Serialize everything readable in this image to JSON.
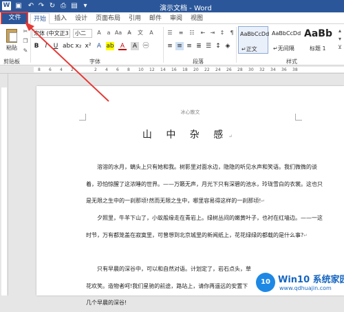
{
  "window": {
    "title": "演示文档 - Word",
    "app_icon_letter": "W"
  },
  "quick_access": [
    "save-icon",
    "undo-icon",
    "redo-icon",
    "refresh-icon",
    "print-icon",
    "open-icon"
  ],
  "tabs": [
    {
      "label": "文件"
    },
    {
      "label": "开始"
    },
    {
      "label": "插入"
    },
    {
      "label": "设计"
    },
    {
      "label": "页面布局"
    },
    {
      "label": "引用"
    },
    {
      "label": "邮件"
    },
    {
      "label": "审阅"
    },
    {
      "label": "视图"
    }
  ],
  "ribbon": {
    "clipboard": {
      "paste_label": "粘贴",
      "group_label": "剪贴板"
    },
    "font": {
      "font_name": "宋体 (中文正3",
      "font_size": "小二",
      "group_label": "字体"
    },
    "paragraph": {
      "group_label": "段落"
    },
    "styles": {
      "group_label": "样式",
      "items": [
        {
          "preview": "AaBbCcDd",
          "name": "↵正文"
        },
        {
          "preview": "AaBbCcDd",
          "name": "↵无间隔"
        },
        {
          "preview": "AaBb",
          "name": "标题 1"
        }
      ]
    }
  },
  "ruler": {
    "numbers": [
      "8",
      "6",
      "4",
      "2",
      "2",
      "4",
      "6",
      "8",
      "10",
      "12",
      "14",
      "16",
      "18",
      "20",
      "22",
      "24",
      "26",
      "28",
      "30",
      "32",
      "34",
      "36",
      "38"
    ]
  },
  "document": {
    "header": "冰心散文",
    "title": "山 中 杂 感",
    "paragraphs": [
      "溶溶的水月，螭头上只有她和我。树影里对面水边，隐隐的听见水声和笑语。我们微微的谈着，恐怕惊醒了这浓睡的世界。——万籁无声，月光下只有深碧的池水，玲珑雪白的衣裳。这也只是无限之生中的一刹那顷!然而无限之生中，哪里容易得这样的一刹那顷!",
      "夕照里，牛羊下山了，小蚁般缘走在青岩上。绿树丛间的嫩黄叶子，也衬在红墙边。——一这时节，万有都笼盖在寂寞里，可曾想到北京城里的新闻纸上，花花绿绿的都载的是什么事?",
      "只有早晨的深谷中，可以和自然对语。计划定了，岩石点头，草花欢笑。造物者呵!我们星驰的前途，路站上，请你再遥远的安置下几个早晨的深谷!"
    ]
  },
  "watermark": {
    "logo": "10",
    "title": "Win10 系统家园",
    "url": "www.qdhuajin.com"
  },
  "colors": {
    "title_bar": "#2b579a",
    "highlight": "#e53935"
  }
}
